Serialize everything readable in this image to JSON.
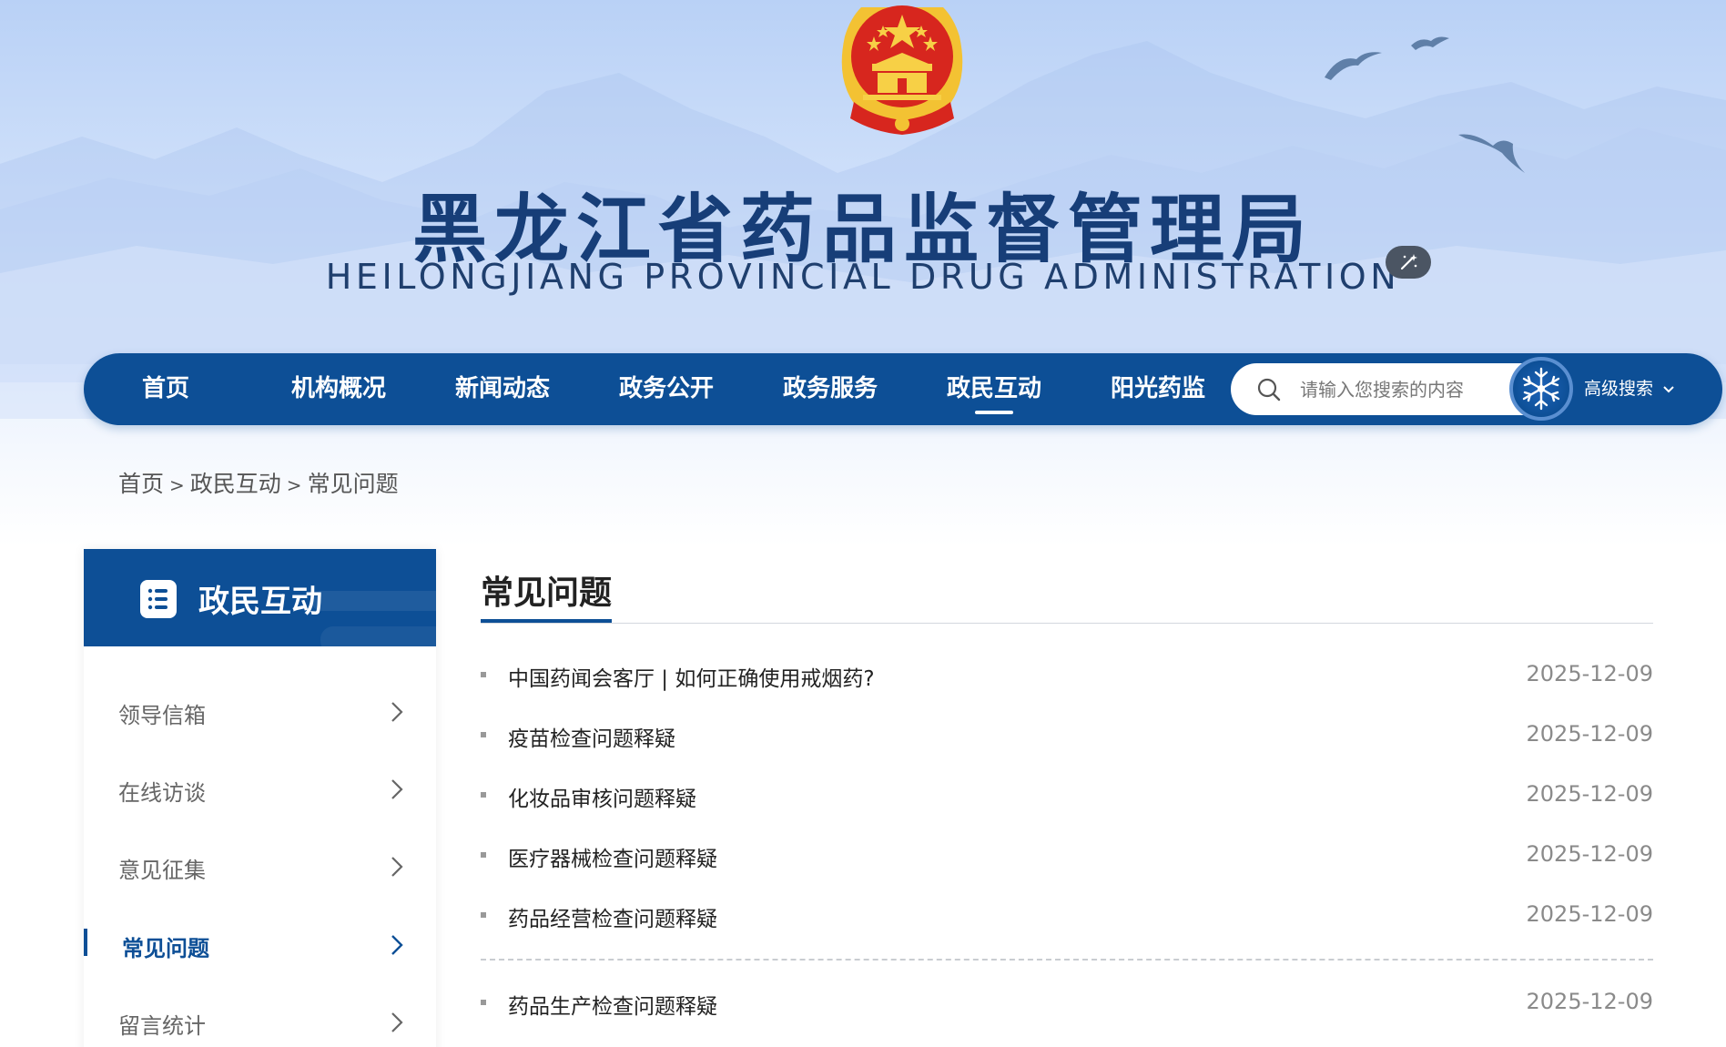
{
  "header": {
    "title_cn": "黑龙江省药品监督管理局",
    "title_en": "HEILONGJIANG PROVINCIAL DRUG ADMINISTRATION"
  },
  "nav": {
    "items": [
      {
        "label": "首页"
      },
      {
        "label": "机构概况"
      },
      {
        "label": "新闻动态"
      },
      {
        "label": "政务公开"
      },
      {
        "label": "政务服务"
      },
      {
        "label": "政民互动",
        "active": true
      },
      {
        "label": "阳光药监"
      }
    ],
    "search_placeholder": "请输入您搜索的内容",
    "advanced_search": "高级搜索"
  },
  "breadcrumb": {
    "items": [
      "首页",
      "政民互动",
      "常见问题"
    ],
    "separator": ">"
  },
  "sidebar": {
    "title": "政民互动",
    "items": [
      {
        "label": "领导信箱"
      },
      {
        "label": "在线访谈"
      },
      {
        "label": "意见征集"
      },
      {
        "label": "常见问题",
        "active": true
      },
      {
        "label": "留言统计"
      }
    ]
  },
  "content": {
    "title": "常见问题",
    "items": [
      {
        "title": "中国药闻会客厅 | 如何正确使用戒烟药?",
        "date": "2025-12-09"
      },
      {
        "title": "疫苗检查问题释疑",
        "date": "2025-12-09"
      },
      {
        "title": "化妆品审核问题释疑",
        "date": "2025-12-09"
      },
      {
        "title": "医疗器械检查问题释疑",
        "date": "2025-12-09"
      },
      {
        "title": "药品经营检查问题释疑",
        "date": "2025-12-09"
      },
      {
        "title": "药品生产检查问题释疑",
        "date": "2025-12-09"
      }
    ]
  },
  "colors": {
    "brand_blue": "#0d4f96",
    "title_blue": "#173e78",
    "emblem_red": "#d7261e",
    "emblem_gold": "#f3c233"
  }
}
